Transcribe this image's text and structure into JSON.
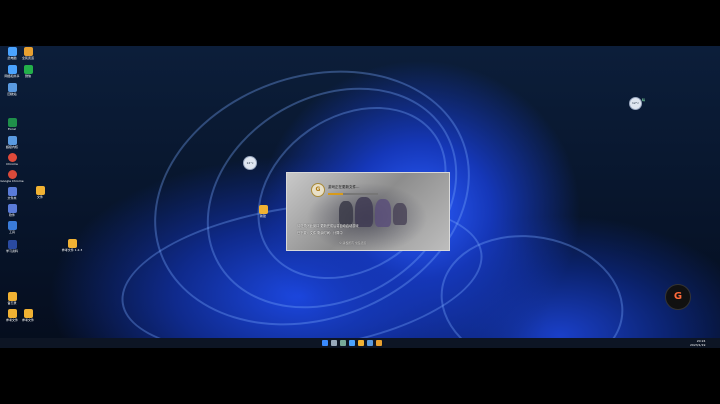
{
  "desktop": {
    "icons": [
      {
        "label": "此电脑",
        "color": "#4aa3ff"
      },
      {
        "label": "全民武道",
        "color": "#e8a030"
      },
      {
        "label": "网络和共享",
        "color": "#4aa3ff"
      },
      {
        "label": "微信",
        "color": "#23b04a"
      },
      {
        "label": "回收站",
        "color": "#5a9ae0"
      },
      {
        "label": "Excel",
        "color": "#1f8f4a"
      },
      {
        "label": "超级内核",
        "color": "#5a9ae0"
      },
      {
        "label": "Chrome",
        "color": "#e04a3a"
      },
      {
        "label": "Google Chrome",
        "color": "#d94a3a"
      },
      {
        "label": "文件夹",
        "color": "#5a7bd8"
      },
      {
        "label": "软件",
        "color": "#5a7bd8"
      },
      {
        "label": "工具",
        "color": "#3a7bd8"
      },
      {
        "label": "学习资料",
        "color": "#f1b233"
      },
      {
        "label": "备忘录",
        "color": "#f1b233"
      },
      {
        "label": "参考文件",
        "color": "#f1b233"
      }
    ],
    "folder_1_label": "文件",
    "folder_2_label": "参考文件 1.2.3",
    "center_folder_label": "新建",
    "widget_value": "12°c",
    "widget_label": "晴"
  },
  "dialog": {
    "title": "游戏正在更新文件…",
    "progress": 0.3,
    "line1": "请勿关闭此窗口  更新完成后将自动启动游戏",
    "line2": "已下载：文件  剩余时间：计算中",
    "footer": "© 版权所有 全民武道"
  },
  "floating_button_label": "G",
  "taskbar": {
    "clock_time": "20:24",
    "clock_date": "2023/1/19"
  }
}
